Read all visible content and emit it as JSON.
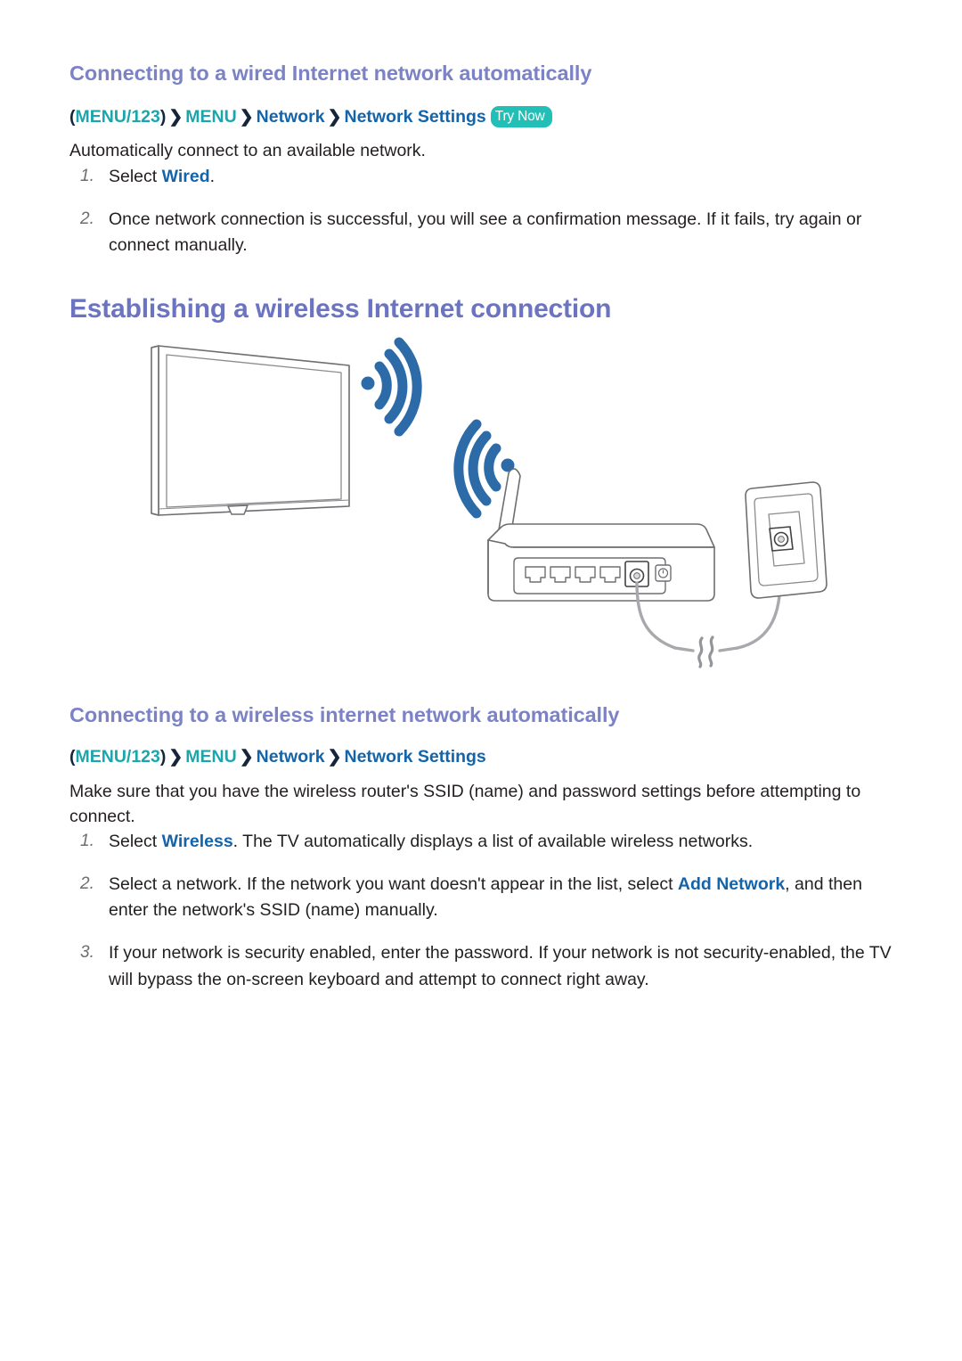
{
  "document": {
    "title": "Establishing a wireless Internet connection"
  },
  "section_wired": {
    "heading": "Connecting to a wired Internet network automatically",
    "breadcrumb": {
      "open_paren": "(",
      "menu123": "MENU/123",
      "close_paren": ")",
      "separator": "❯",
      "menu": "MENU",
      "network": "Network",
      "network_settings": "Network Settings",
      "try_now_badge": "Try Now"
    },
    "intro": "Automatically connect to an available network.",
    "steps": [
      {
        "number": "1.",
        "parts": [
          {
            "text": "Select ",
            "style": "normal"
          },
          {
            "text": "Wired",
            "style": "highlight"
          },
          {
            "text": ".",
            "style": "normal"
          }
        ]
      },
      {
        "number": "2.",
        "parts": [
          {
            "text": "Once network connection is successful, you will see a confirmation message. If it fails, try again or connect manually.",
            "style": "normal"
          }
        ]
      }
    ]
  },
  "section_wireless_title": {
    "heading": "Establishing a wireless Internet connection"
  },
  "section_wireless": {
    "heading": "Connecting to a wireless internet network automatically",
    "breadcrumb": {
      "open_paren": "(",
      "menu123": "MENU/123",
      "close_paren": ")",
      "separator": "❯",
      "menu": "MENU",
      "network": "Network",
      "network_settings": "Network Settings"
    },
    "intro": "Make sure that you have the wireless router's SSID (name) and password settings before attempting to connect.",
    "steps": [
      {
        "number": "1.",
        "parts": [
          {
            "text": "Select ",
            "style": "normal"
          },
          {
            "text": "Wireless",
            "style": "highlight"
          },
          {
            "text": ". The TV automatically displays a list of available wireless networks.",
            "style": "normal"
          }
        ]
      },
      {
        "number": "2.",
        "parts": [
          {
            "text": "Select a network. If the network you want doesn't appear in the list, select ",
            "style": "normal"
          },
          {
            "text": "Add Network",
            "style": "highlight"
          },
          {
            "text": ", and then enter the network's SSID (name) manually.",
            "style": "normal"
          }
        ]
      },
      {
        "number": "3.",
        "parts": [
          {
            "text": "If your network is security enabled, enter the password. If your network is not security-enabled, the TV will bypass the on-screen keyboard and attempt to connect right away.",
            "style": "normal"
          }
        ]
      }
    ]
  },
  "illustration": {
    "alt": "Television receiving wireless signal from a wireless router connected to a wall network outlet",
    "parts": {
      "tv": "television",
      "wifi_signal_tv": "wifi-waves-from-tv",
      "wifi_signal_router": "wifi-waves-from-router",
      "router": "wireless-router",
      "antenna": "router-antenna",
      "lan_ports": "router-lan-ports",
      "wan_port": "router-wan-port",
      "power_jack": "router-power-jack",
      "cable": "ethernet-cable",
      "cable_break": "cable-break-symbol",
      "wall_outlet": "wall-network-outlet"
    }
  },
  "colors": {
    "heading_purple": "#6b74c0",
    "subheading_purple": "#7b82c6",
    "crumb_teal": "#1ba6ad",
    "crumb_blue": "#1464aa",
    "highlight_blue": "#1464aa",
    "badge_teal": "#22bfb6",
    "wifi_blue": "#2d6aa8",
    "line_gray": "#8a8c8e",
    "body_black": "#231f20",
    "step_number_gray": "#6d6e71"
  }
}
